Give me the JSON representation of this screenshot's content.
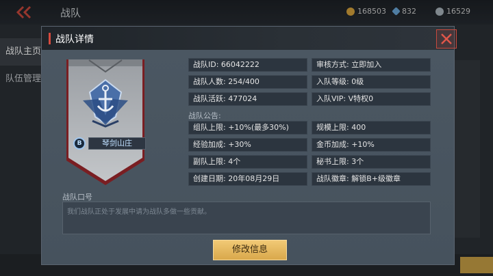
{
  "background": {
    "title": "战队",
    "currencies": [
      {
        "icon": "gold-coin-icon",
        "value": "168503",
        "color": "#d7a33c"
      },
      {
        "icon": "diamond-icon",
        "value": "832",
        "color": "#6aa7d9"
      },
      {
        "icon": "silver-coin-icon",
        "value": "16529",
        "color": "#aab4bd"
      }
    ],
    "sidebar": [
      "战队主页",
      "队伍管理"
    ]
  },
  "dialog": {
    "title": "战队详情",
    "banner": {
      "name": "琴剑山庄",
      "badge": "B"
    },
    "info_left": [
      "战队ID: 66042222",
      "战队人数: 254/400",
      "战队活跃: 477024"
    ],
    "info_right": [
      "审核方式: 立即加入",
      "入队等级: 0级",
      "入队VIP: V特权0"
    ],
    "announcement_label": "战队公告:",
    "announcement_left": [
      "组队上限: +10%(最多30%)",
      "经验加成: +30%",
      "副队上限: 4个",
      "创建日期: 20年08月29日"
    ],
    "announcement_right": [
      "规模上限: 400",
      "金币加成: +10%",
      "秘书上限: 3个",
      "战队徽章: 解锁B+级徽章"
    ],
    "slogan_label": "战队口号",
    "slogan_text": "我们战队正处于发展中请为战队多做一些贡献。",
    "edit_button": "修改信息"
  },
  "colors": {
    "accent": "#d64a3e",
    "button": "#e8bb62"
  }
}
